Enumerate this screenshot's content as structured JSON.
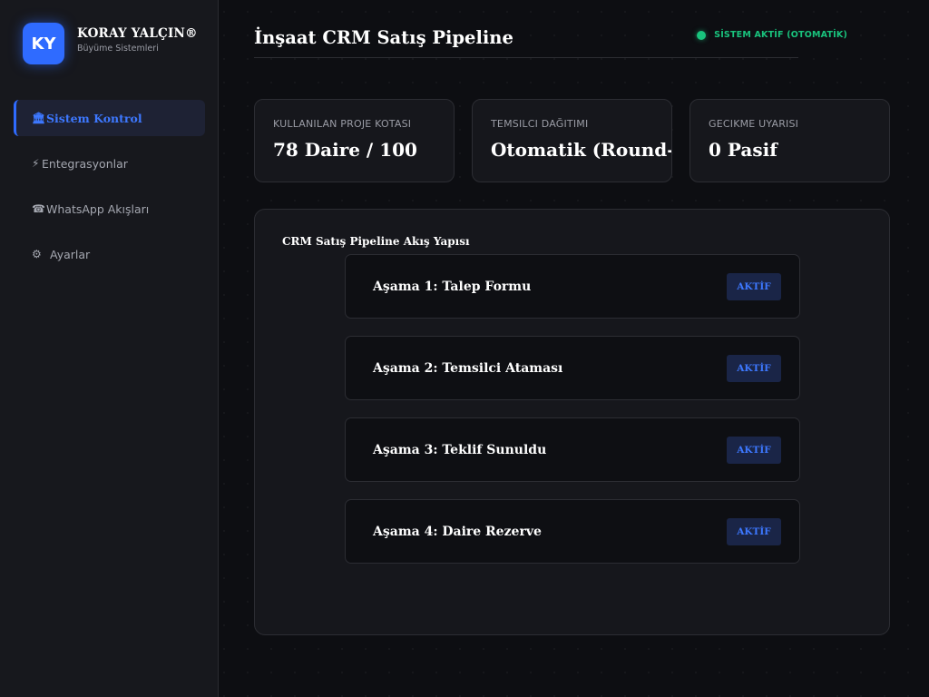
{
  "brand": {
    "logo_initials": "KY",
    "name": "KORAY YALÇIN®",
    "subtitle": "Büyüme Sistemleri"
  },
  "sidebar": {
    "items": [
      {
        "label": "Sistem Kontrol",
        "icon": "building-columns-icon",
        "active": true
      },
      {
        "label": "Entegrasyonlar",
        "icon": "lightning-icon",
        "active": false
      },
      {
        "label": "WhatsApp Akışları",
        "icon": "phone-icon",
        "active": false
      },
      {
        "label": "Ayarlar",
        "icon": "gear-icon",
        "active": false
      }
    ]
  },
  "header": {
    "title": "İnşaat CRM Satış Pipeline",
    "status": "SİSTEM AKTİF (OTOMATİK)"
  },
  "stats": [
    {
      "label": "KULLANILAN PROJE KOTASI",
      "value": "78 Daire / 100"
    },
    {
      "label": "TEMSILCI DAĞITIMI",
      "value": "Otomatik (Round-Robin)"
    },
    {
      "label": "GECIKME UYARISI",
      "value": "0 Pasif"
    }
  ],
  "pipeline": {
    "title": "CRM Satış Pipeline Akış Yapısı",
    "stages": [
      {
        "label": "Aşama 1: Talep Formu",
        "status": "AKTİF"
      },
      {
        "label": "Aşama 2: Temsilci Ataması",
        "status": "AKTİF"
      },
      {
        "label": "Aşama 3: Teklif Sunuldu",
        "status": "AKTİF"
      },
      {
        "label": "Aşama 4: Daire Rezerve",
        "status": "AKTİF"
      }
    ]
  },
  "colors": {
    "accent": "#2f6bff",
    "status_green": "#19c37d",
    "background": "#0d0e12",
    "panel": "#16171c"
  }
}
